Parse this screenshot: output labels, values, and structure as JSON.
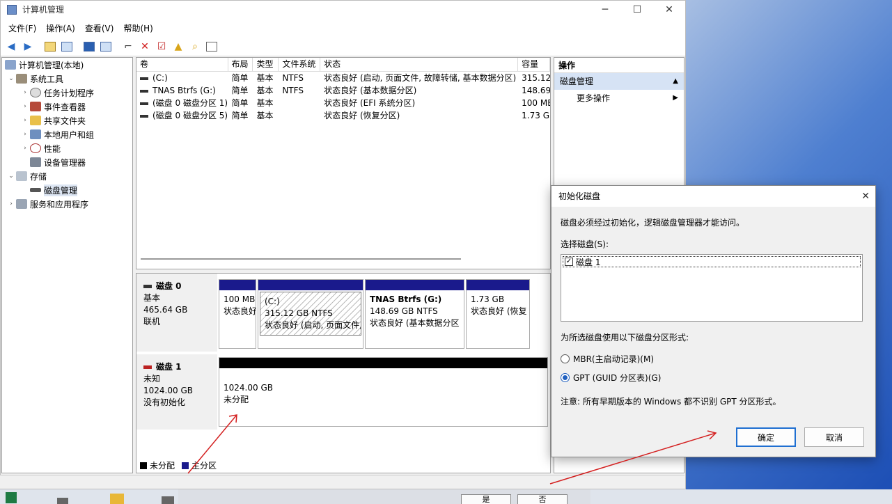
{
  "window": {
    "title": "计算机管理",
    "controls": {
      "minimize": "─",
      "maximize": "☐",
      "close": "✕"
    }
  },
  "menu": [
    "文件(F)",
    "操作(A)",
    "查看(V)",
    "帮助(H)"
  ],
  "tree": {
    "root": "计算机管理(本地)",
    "system_tools": "系统工具",
    "task_scheduler": "任务计划程序",
    "event_viewer": "事件查看器",
    "shared_folders": "共享文件夹",
    "local_users": "本地用户和组",
    "performance": "性能",
    "device_manager": "设备管理器",
    "storage": "存储",
    "disk_management": "磁盘管理",
    "services": "服务和应用程序"
  },
  "volumes": {
    "headers": [
      "卷",
      "布局",
      "类型",
      "文件系统",
      "状态",
      "容量"
    ],
    "rows": [
      {
        "name": "(C:)",
        "layout": "简单",
        "type": "基本",
        "fs": "NTFS",
        "status": "状态良好 (启动, 页面文件, 故障转储, 基本数据分区)",
        "capacity": "315.12"
      },
      {
        "name": "TNAS Btrfs  (G:)",
        "layout": "简单",
        "type": "基本",
        "fs": "NTFS",
        "status": "状态良好 (基本数据分区)",
        "capacity": "148.69"
      },
      {
        "name": "(磁盘 0 磁盘分区 1)",
        "layout": "简单",
        "type": "基本",
        "fs": "",
        "status": "状态良好 (EFI 系统分区)",
        "capacity": "100 MB"
      },
      {
        "name": "(磁盘 0 磁盘分区 5)",
        "layout": "简单",
        "type": "基本",
        "fs": "",
        "status": "状态良好 (恢复分区)",
        "capacity": "1.73 GB"
      }
    ]
  },
  "disk0": {
    "name": "磁盘 0",
    "type": "基本",
    "size": "465.64 GB",
    "state": "联机",
    "p1_size": "100 MB",
    "p1_status": "状态良好",
    "p2_name": "(C:)",
    "p2_size": "315.12 GB NTFS",
    "p2_status": "状态良好 (启动, 页面文件,",
    "p3_name": "TNAS Btrfs   (G:)",
    "p3_size": "148.69 GB NTFS",
    "p3_status": "状态良好 (基本数据分区",
    "p4_size": "1.73 GB",
    "p4_status": "状态良好 (恢复"
  },
  "disk1": {
    "name": "磁盘 1",
    "type": "未知",
    "size": "1024.00 GB",
    "state": "没有初始化",
    "p_size": "1024.00 GB",
    "p_status": "未分配"
  },
  "legend": {
    "unallocated": "未分配",
    "primary": "主分区"
  },
  "actions": {
    "header": "操作",
    "selected": "磁盘管理",
    "more": "更多操作"
  },
  "dialog": {
    "title": "初始化磁盘",
    "message": "磁盘必须经过初始化，逻辑磁盘管理器才能访问。",
    "select_label": "选择磁盘(S):",
    "disk_item": "磁盘 1",
    "style_label": "为所选磁盘使用以下磁盘分区形式:",
    "mbr": "MBR(主启动记录)(M)",
    "gpt": "GPT (GUID 分区表)(G)",
    "note": "注意: 所有早期版本的 Windows 都不识别 GPT 分区形式。",
    "ok": "确定",
    "cancel": "取消"
  },
  "taskbar": {
    "yes": "是",
    "no": "否"
  },
  "colors": {
    "primary_partition": "#1a1a8c",
    "unallocated": "#000000",
    "annotation": "#d42020"
  }
}
